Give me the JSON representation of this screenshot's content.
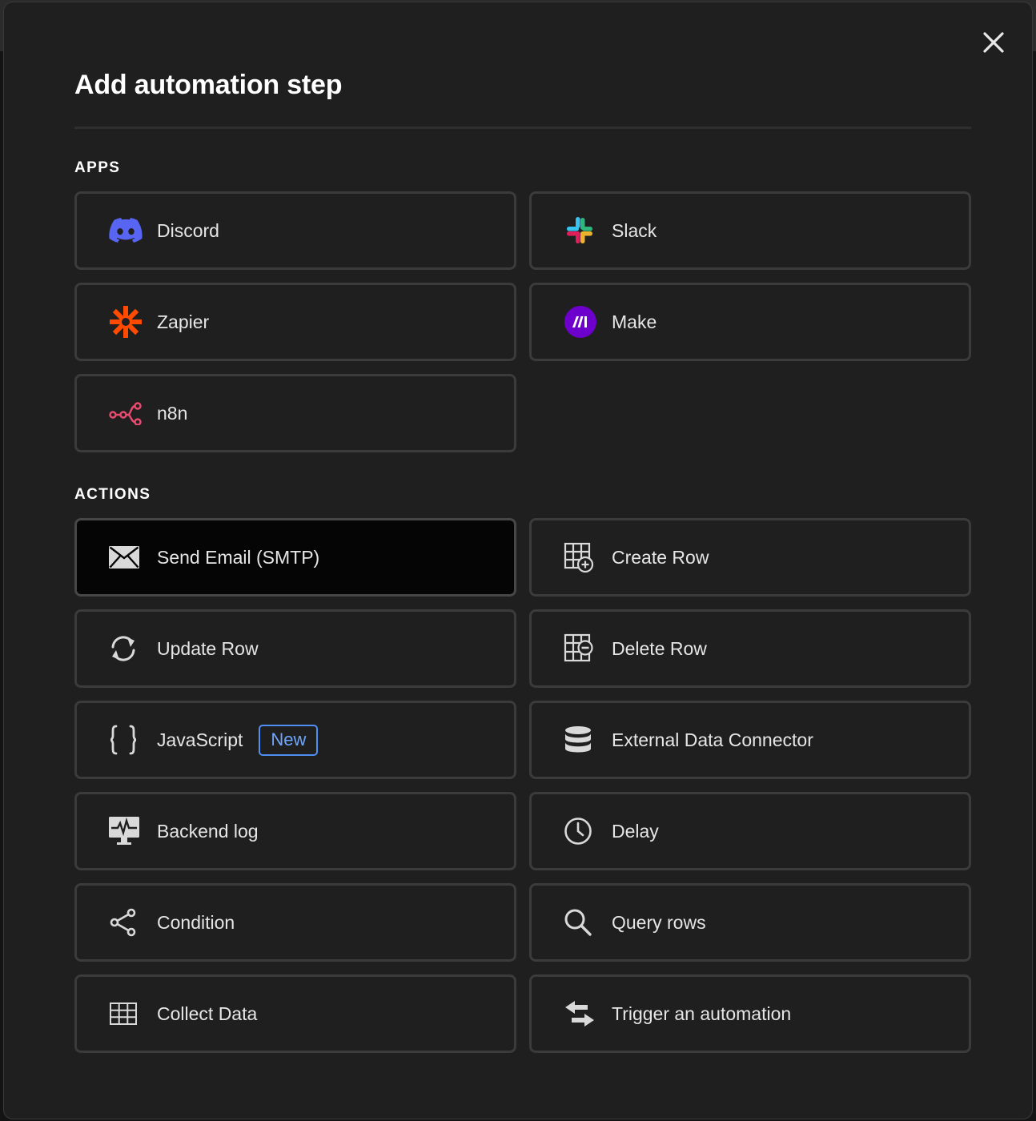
{
  "dialog": {
    "title": "Add automation step",
    "close_icon": "close-icon"
  },
  "apps": {
    "section_label": "APPS",
    "items": [
      {
        "label": "Discord",
        "icon": "discord-icon",
        "color": "#5865F2"
      },
      {
        "label": "Slack",
        "icon": "slack-icon"
      },
      {
        "label": "Zapier",
        "icon": "zapier-icon",
        "color": "#FF4A00"
      },
      {
        "label": "Make",
        "icon": "make-icon",
        "color": "#6D00CC"
      },
      {
        "label": "n8n",
        "icon": "n8n-icon",
        "color": "#EA4B71"
      }
    ]
  },
  "actions": {
    "section_label": "ACTIONS",
    "items": [
      {
        "label": "Send Email (SMTP)",
        "icon": "envelope-icon",
        "selected": true
      },
      {
        "label": "Create Row",
        "icon": "table-add-icon"
      },
      {
        "label": "Update Row",
        "icon": "refresh-icon"
      },
      {
        "label": "Delete Row",
        "icon": "table-remove-icon"
      },
      {
        "label": "JavaScript",
        "icon": "braces-icon",
        "badge": "New"
      },
      {
        "label": "External Data Connector",
        "icon": "database-icon"
      },
      {
        "label": "Backend log",
        "icon": "monitor-pulse-icon"
      },
      {
        "label": "Delay",
        "icon": "clock-icon"
      },
      {
        "label": "Condition",
        "icon": "branch-icon"
      },
      {
        "label": "Query rows",
        "icon": "search-icon"
      },
      {
        "label": "Collect Data",
        "icon": "grid-icon"
      },
      {
        "label": "Trigger an automation",
        "icon": "swap-arrows-icon"
      }
    ]
  },
  "colors": {
    "badge_accent": "#4F8FF2",
    "selected_card_bg": "#050505"
  }
}
